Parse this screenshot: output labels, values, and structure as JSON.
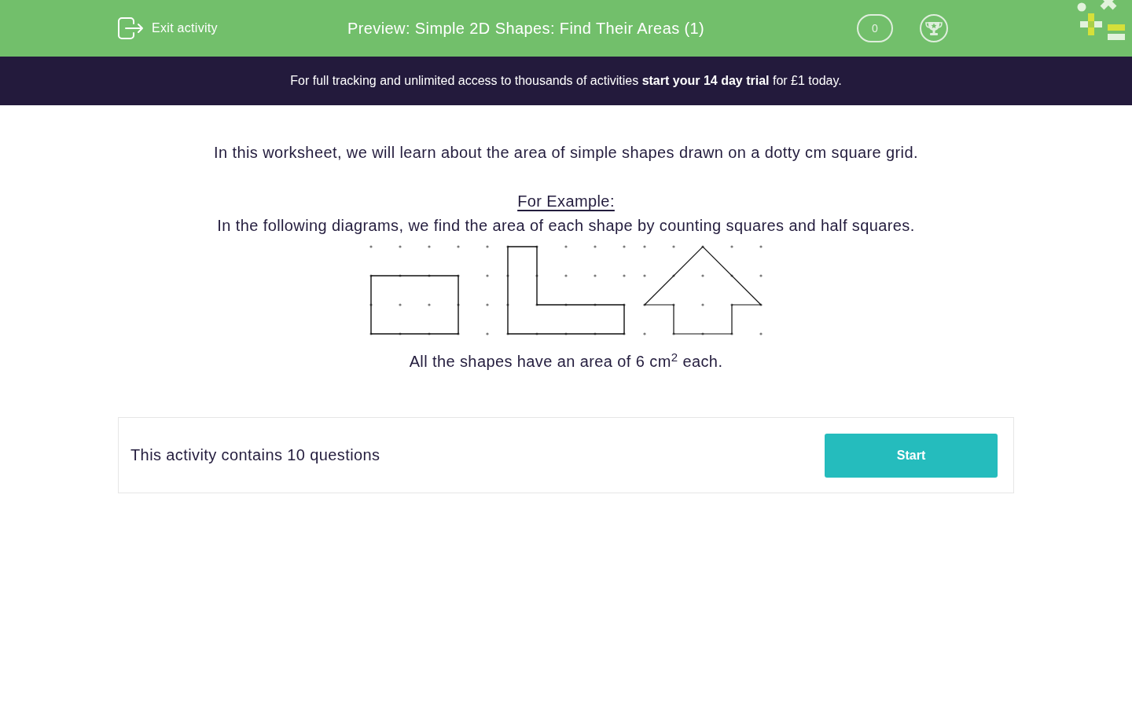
{
  "header": {
    "exit_label": "Exit activity",
    "title": "Preview: Simple 2D Shapes: Find Their Areas (1)",
    "score": "0"
  },
  "banner": {
    "text": "For full tracking and unlimited access to thousands of activities **start your 14 day trial** for £1 today."
  },
  "intro": {
    "text": "In this worksheet, we will learn about the area of simple shapes drawn on a dotty cm square grid.",
    "example_heading": "For Example:",
    "example_text": "In the following diagrams, we find the area of each shape by counting squares and half squares.",
    "caption": "All the shapes have an area of 6 cm$^{2}$ each."
  },
  "activity": {
    "text": "This activity contains 10 questions",
    "button": "Start"
  }
}
